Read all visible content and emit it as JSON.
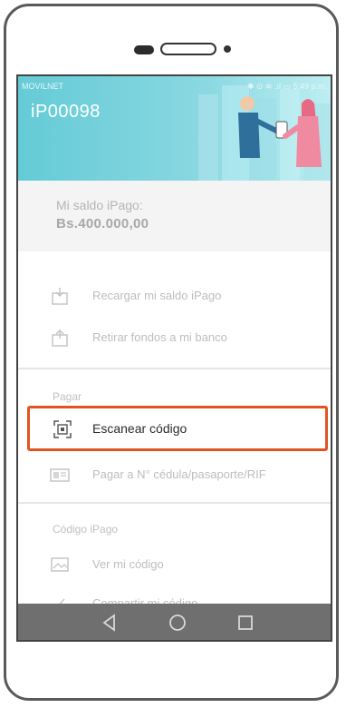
{
  "status_bar": {
    "carrier": "MOVILNET",
    "right": "✱ ⊙ ≋ .ıl ▭ 5:49 p.m."
  },
  "header": {
    "account_id": "iP00098"
  },
  "balance": {
    "label": "Mi saldo iPago:",
    "amount": "Bs.400.000,00"
  },
  "menu": {
    "recharge": "Recargar mi saldo iPago",
    "withdraw": "Retirar fondos a mi banco",
    "pay_section": "Pagar",
    "scan": "Escanear código",
    "pay_id": "Pagar a N° cédula/pasaporte/RIF",
    "code_section": "Código iPago",
    "view_code": "Ver mi código",
    "share_code": "Compartir mi código"
  },
  "colors": {
    "header": "#64cbd6",
    "highlight": "#e2541f",
    "navbar": "#6f6f6f"
  }
}
